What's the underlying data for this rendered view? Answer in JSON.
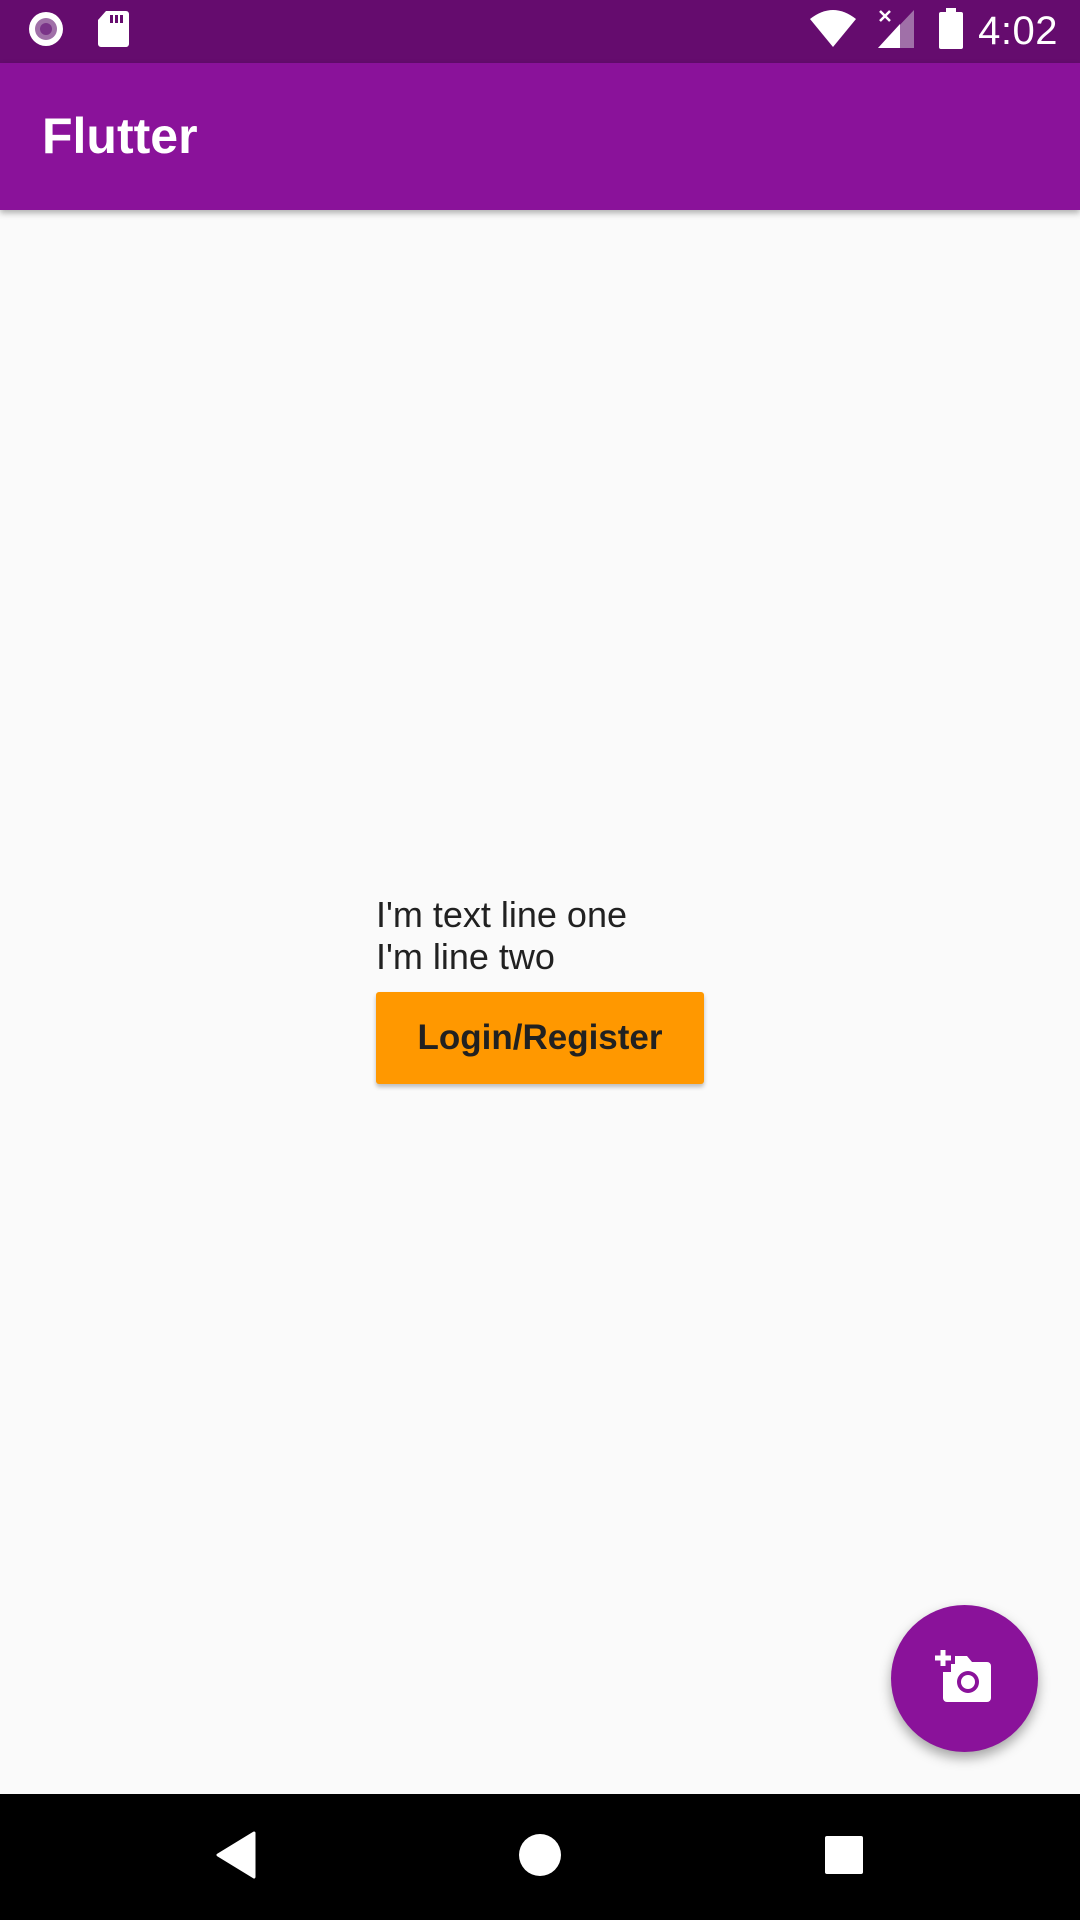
{
  "status_bar": {
    "time": "4:02",
    "left_icons": [
      "record-icon",
      "sd-card-icon"
    ],
    "right_icons": [
      "wifi-icon",
      "signal-no-data-icon",
      "battery-icon"
    ]
  },
  "app_bar": {
    "title": "Flutter"
  },
  "body": {
    "line_one": "I'm text line one",
    "line_two": "I'm line two",
    "button_label": "Login/Register"
  },
  "fab": {
    "icon": "add-a-photo-icon"
  },
  "nav_bar": {
    "buttons": [
      "back-icon",
      "home-icon",
      "recents-icon"
    ]
  },
  "colors": {
    "status_bar": "#650c6e",
    "app_bar": "#8a129a",
    "background": "#fafafa",
    "button": "#ff9800",
    "fab": "#8a129a",
    "nav_bar": "#000000"
  }
}
